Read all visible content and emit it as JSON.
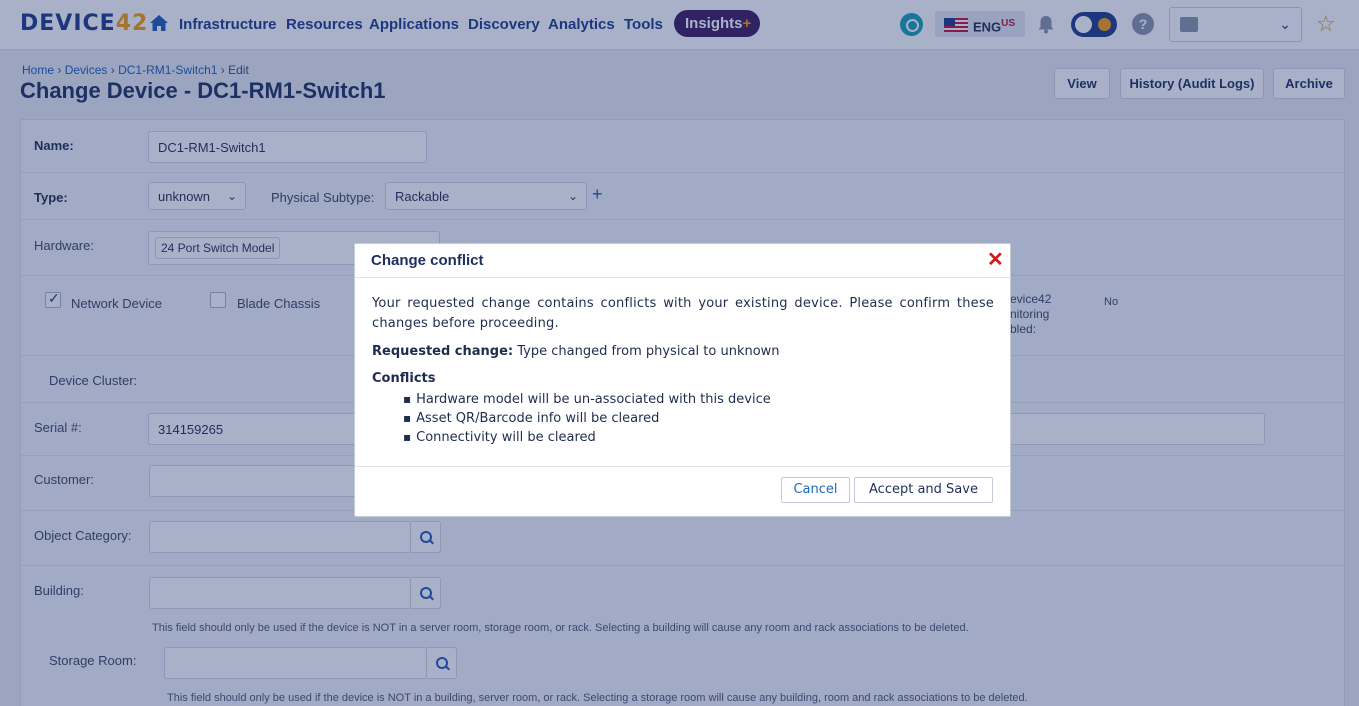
{
  "brand": {
    "logo_main": "DEVICE",
    "logo_num": "42"
  },
  "nav": {
    "items": [
      "Infrastructure",
      "Resources",
      "Applications",
      "Discovery",
      "Analytics",
      "Tools"
    ],
    "insights": "Insights",
    "insights_plus": "+",
    "lang": "ENG",
    "lang_region": "US"
  },
  "breadcrumb": {
    "home": "Home",
    "devices": "Devices",
    "device": "DC1-RM1-Switch1",
    "current": "Edit",
    "sep": "›"
  },
  "page": {
    "title": "Change Device - DC1-RM1-Switch1",
    "buttons": {
      "view": "View",
      "history": "History (Audit Logs)",
      "archive": "Archive"
    }
  },
  "form": {
    "name_label": "Name:",
    "name_value": "DC1-RM1-Switch1",
    "type_label": "Type:",
    "type_value": "unknown",
    "subtype_label": "Physical Subtype:",
    "subtype_value": "Rackable",
    "hardware_label": "Hardware:",
    "hardware_value": "24 Port Switch Model",
    "network_device": "Network Device",
    "blade_chassis": "Blade Chassis",
    "monitoring_line1": "evice42",
    "monitoring_line2": "nitoring",
    "monitoring_line3": "bled:",
    "monitoring_value": "No",
    "cluster_label": "Device Cluster:",
    "serial_label": "Serial #:",
    "serial_value": "314159265",
    "customer_label": "Customer:",
    "object_category_label": "Object Category:",
    "building_label": "Building:",
    "building_hint": "This field should only be used if the device is NOT in a server room, storage room, or rack. Selecting a building will cause any room and rack associations to be deleted.",
    "storage_room_label": "Storage Room:",
    "storage_hint": "This field should only be used if the device is NOT in a building, server room, or rack. Selecting a storage room will cause any building, room and rack associations to be deleted."
  },
  "modal": {
    "title": "Change conflict",
    "close": "✕",
    "message": "Your requested change contains conflicts with your existing device. Please confirm these changes before proceeding.",
    "requested_label": "Requested change:",
    "requested_value": "Type changed from physical to unknown",
    "conflicts_title": "Conflicts",
    "conflicts": [
      "Hardware model will be un-associated with this device",
      "Asset QR/Barcode info will be cleared",
      "Connectivity will be cleared"
    ],
    "cancel": "Cancel",
    "accept": "Accept and Save"
  }
}
